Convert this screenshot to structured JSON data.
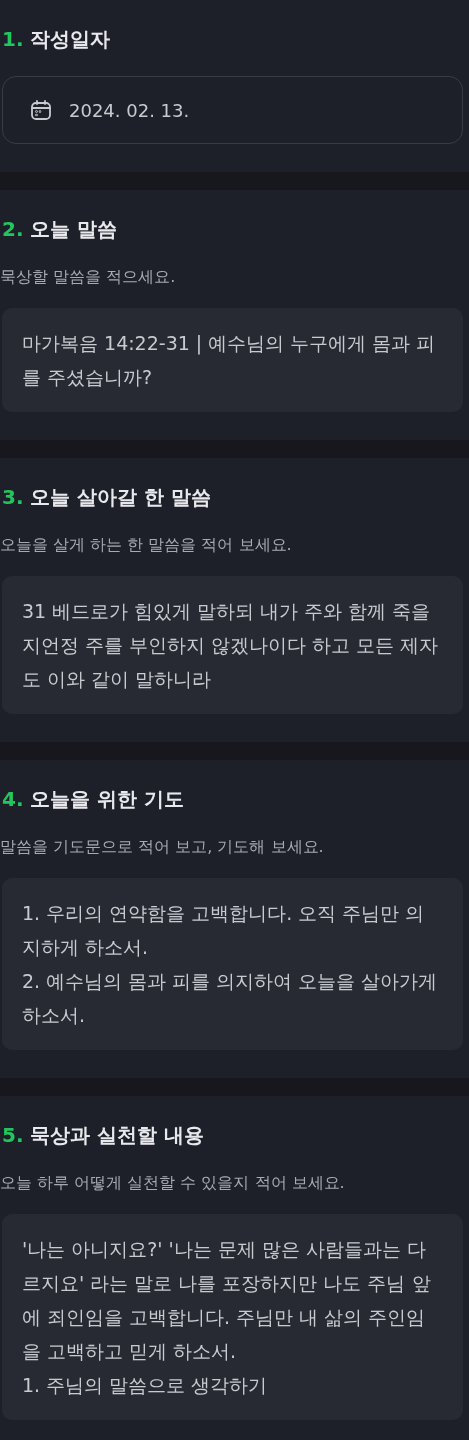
{
  "sections": [
    {
      "number": "1.",
      "title": "작성일자",
      "kind": "date",
      "value": "2024. 02. 13."
    },
    {
      "number": "2.",
      "title": "오늘 말씀",
      "kind": "text",
      "description": "묵상할 말씀을 적으세요.",
      "paragraphs": [
        "마가복음 14:22-31  |  예수님의 누구에게 몸과 피를 주셨습니까?"
      ]
    },
    {
      "number": "3.",
      "title": "오늘 살아갈 한 말씀",
      "kind": "text",
      "description": "오늘을 살게 하는 한 말씀을 적어 보세요.",
      "paragraphs": [
        "31 베드로가 힘있게 말하되 내가 주와 함께 죽을 지언정 주를 부인하지 않겠나이다 하고 모든 제자도 이와 같이 말하니라"
      ]
    },
    {
      "number": "4.",
      "title": "오늘을 위한 기도",
      "kind": "text",
      "description": "말씀을 기도문으로 적어 보고, 기도해 보세요.",
      "paragraphs": [
        "1. 우리의 연약함을 고백합니다. 오직 주님만 의지하게 하소서.",
        "2. 예수님의 몸과 피를 의지하여 오늘을 살아가게 하소서."
      ]
    },
    {
      "number": "5.",
      "title": "묵상과 실천할 내용",
      "kind": "text",
      "description": "오늘 하루 어떻게 실천할 수 있을지 적어 보세요.",
      "paragraphs": [
        "'나는 아니지요?' '나는 문제 많은 사람들과는 다르지요' 라는 말로 나를 포장하지만 나도 주님 앞에 죄인임을 고백합니다. 주님만 내 삶의 주인임을 고백하고 믿게 하소서.",
        "1. 주님의 말씀으로 생각하기"
      ]
    }
  ]
}
